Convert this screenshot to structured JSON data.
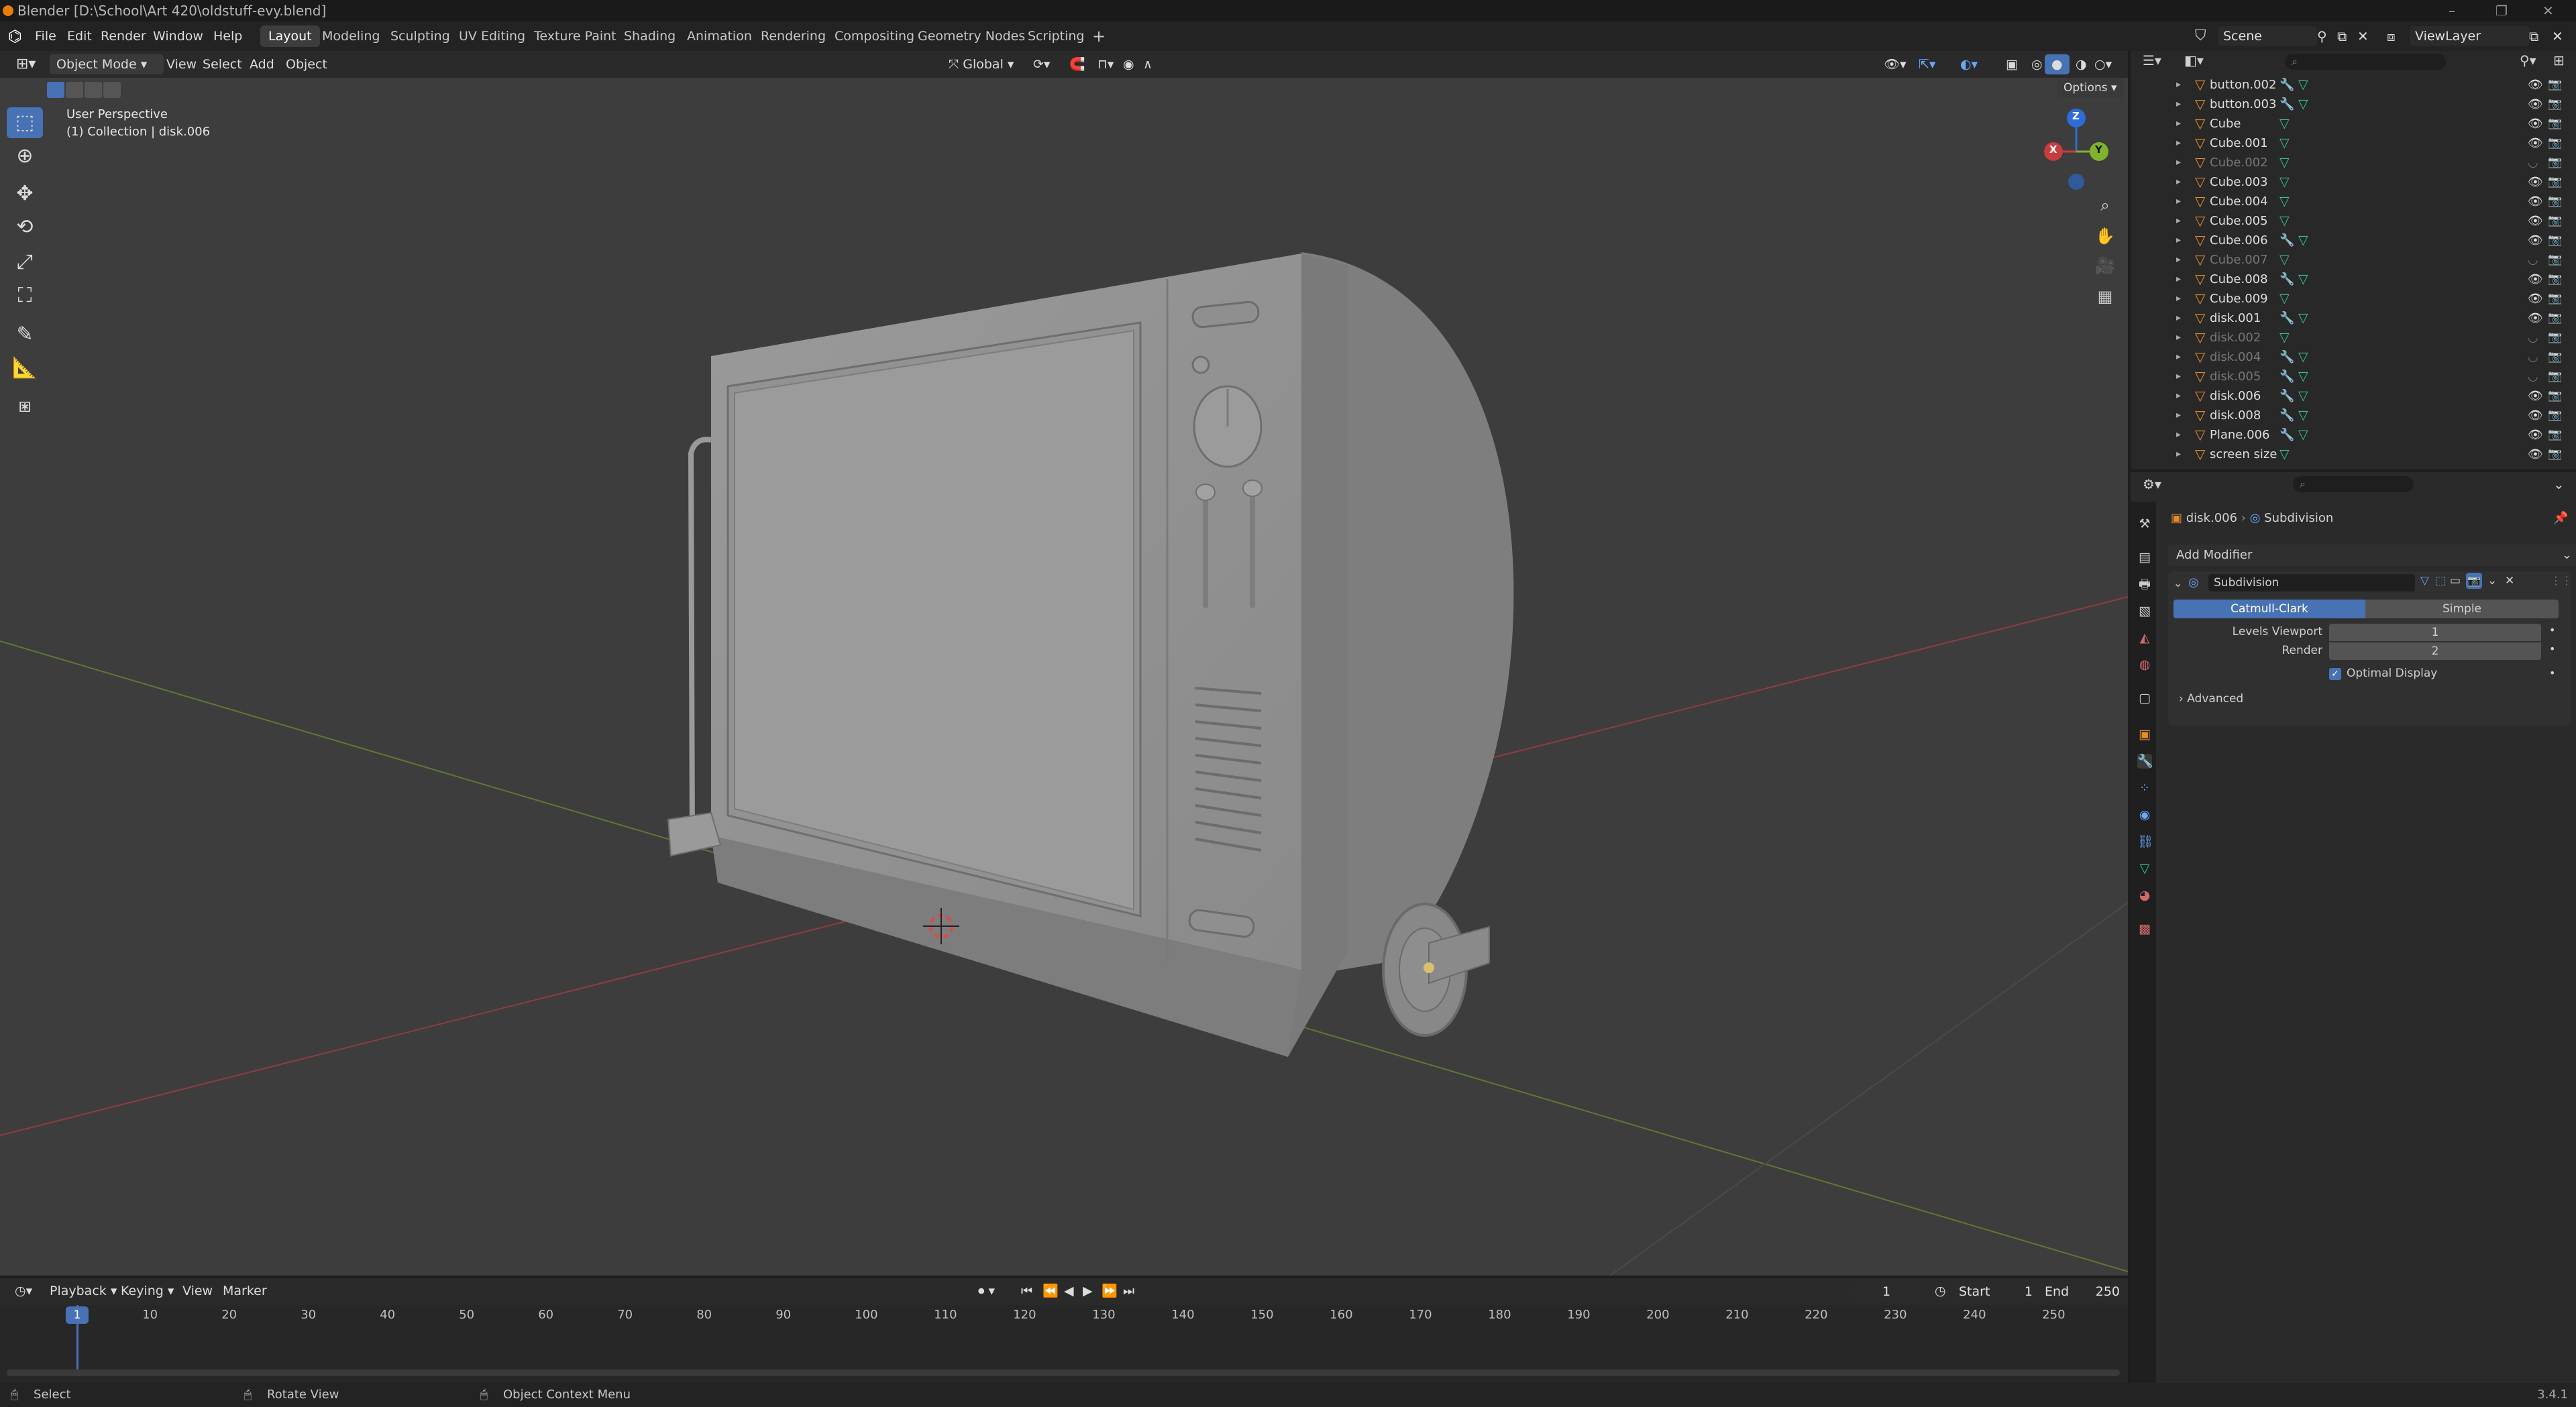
{
  "window": {
    "title": "Blender [D:\\School\\Art 420\\oldstuff-evy.blend]",
    "controls": [
      "–",
      "❐",
      "✕"
    ]
  },
  "topbar": {
    "menus": [
      "File",
      "Edit",
      "Render",
      "Window",
      "Help"
    ],
    "workspaces": [
      "Layout",
      "Modeling",
      "Sculpting",
      "UV Editing",
      "Texture Paint",
      "Shading",
      "Animation",
      "Rendering",
      "Compositing",
      "Geometry Nodes",
      "Scripting"
    ],
    "active_workspace": "Layout",
    "add_workspace": "+",
    "scene": "Scene",
    "view_layer": "ViewLayer"
  },
  "viewport_header": {
    "mode": "Object Mode",
    "menus": [
      "View",
      "Select",
      "Add",
      "Object"
    ],
    "orientation": "Global",
    "options": "Options"
  },
  "viewport": {
    "perspective": "User Perspective",
    "collection": "(1) Collection | disk.006",
    "gizmo_axes": {
      "z": "Z",
      "y": "Y",
      "x": "X"
    },
    "colors": {
      "x_axis": "#c73d3d",
      "y_axis": "#7fb32d",
      "z_axis": "#2f6cd8",
      "model": "#8e8e8e",
      "background": "#3d3d3d"
    }
  },
  "outliner": {
    "items": [
      {
        "name": "button.002",
        "dim": false,
        "modifier": true
      },
      {
        "name": "button.003",
        "dim": false,
        "modifier": true
      },
      {
        "name": "Cube",
        "dim": false,
        "modifier": false
      },
      {
        "name": "Cube.001",
        "dim": false,
        "modifier": false
      },
      {
        "name": "Cube.002",
        "dim": true,
        "modifier": false
      },
      {
        "name": "Cube.003",
        "dim": false,
        "modifier": false
      },
      {
        "name": "Cube.004",
        "dim": false,
        "modifier": false
      },
      {
        "name": "Cube.005",
        "dim": false,
        "modifier": false
      },
      {
        "name": "Cube.006",
        "dim": false,
        "modifier": true
      },
      {
        "name": "Cube.007",
        "dim": true,
        "modifier": false
      },
      {
        "name": "Cube.008",
        "dim": false,
        "modifier": true
      },
      {
        "name": "Cube.009",
        "dim": false,
        "modifier": false
      },
      {
        "name": "disk.001",
        "dim": false,
        "modifier": true
      },
      {
        "name": "disk.002",
        "dim": true,
        "modifier": false
      },
      {
        "name": "disk.004",
        "dim": true,
        "modifier": true
      },
      {
        "name": "disk.005",
        "dim": true,
        "modifier": true
      },
      {
        "name": "disk.006",
        "dim": false,
        "modifier": true
      },
      {
        "name": "disk.008",
        "dim": false,
        "modifier": true
      },
      {
        "name": "Plane.006",
        "dim": false,
        "modifier": true
      },
      {
        "name": "screen size",
        "dim": false,
        "modifier": false
      }
    ]
  },
  "properties": {
    "breadcrumb_object": "disk.006",
    "breadcrumb_modifier": "Subdivision",
    "add_modifier": "Add Modifier",
    "modifier_name": "Subdivision",
    "method_catmull": "Catmull-Clark",
    "method_simple": "Simple",
    "levels_viewport_label": "Levels Viewport",
    "levels_viewport_value": "1",
    "render_label": "Render",
    "render_value": "2",
    "optimal_display": "Optimal Display",
    "optimal_display_checked": true,
    "advanced": "Advanced"
  },
  "timeline": {
    "menus": [
      "Playback",
      "Keying",
      "View",
      "Marker"
    ],
    "current_frame": "1",
    "start_label": "Start",
    "start": "1",
    "end_label": "End",
    "end": "250",
    "ticks": [
      "1",
      "10",
      "20",
      "30",
      "40",
      "50",
      "60",
      "70",
      "80",
      "90",
      "100",
      "110",
      "120",
      "130",
      "140",
      "150",
      "160",
      "170",
      "180",
      "190",
      "200",
      "210",
      "220",
      "230",
      "240",
      "250"
    ]
  },
  "statusbar": {
    "select": "Select",
    "rotate": "Rotate View",
    "context": "Object Context Menu",
    "version": "3.4.1"
  }
}
